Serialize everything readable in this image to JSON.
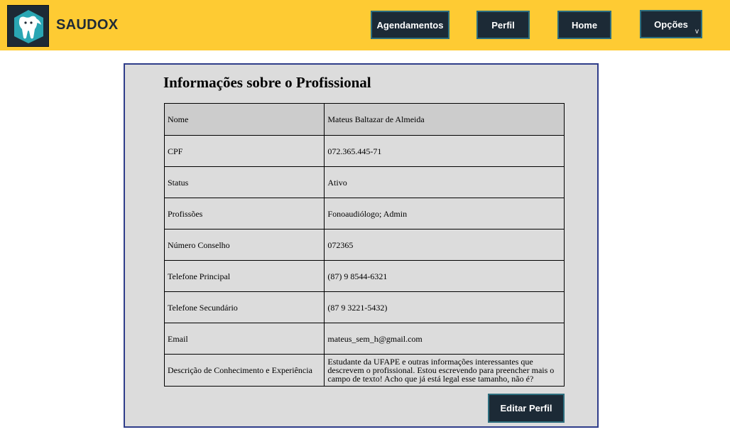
{
  "header": {
    "brand": "SAUDOX",
    "logo_icon": "tooth-mascot-icon",
    "nav": {
      "agendamentos": "Agendamentos",
      "perfil": "Perfil",
      "home": "Home",
      "opcoes": "Opções",
      "opcoes_chevron": "v"
    }
  },
  "panel": {
    "title": "Informações sobre o Profissional",
    "rows": [
      {
        "label": "Nome",
        "value": "Mateus Baltazar de Almeida"
      },
      {
        "label": "CPF",
        "value": "072.365.445-71"
      },
      {
        "label": "Status",
        "value": "Ativo"
      },
      {
        "label": "Profissões",
        "value": "Fonoaudiólogo; Admin"
      },
      {
        "label": "Número Conselho",
        "value": "072365"
      },
      {
        "label": "Telefone Principal",
        "value": "(87) 9 8544-6321"
      },
      {
        "label": "Telefone Secundário",
        "value": "(87 9 3221-5432)"
      },
      {
        "label": "Email",
        "value": "mateus_sem_h@gmail.com"
      },
      {
        "label": "Descrição de Conhecimento e Experiência",
        "value": "Estudante da UFAPE e outras informações interessantes que descrevem o profissional. Estou escrevendo para preencher mais o campo de texto! Acho que já está legal esse tamanho, não é?"
      }
    ],
    "edit_button": "Editar Perfil"
  },
  "colors": {
    "topbar": "#fecb33",
    "button_bg": "#1c2a36",
    "button_border": "#2d6e7e",
    "panel_bg": "#dcdcdc",
    "panel_border": "#2f3d8a"
  }
}
